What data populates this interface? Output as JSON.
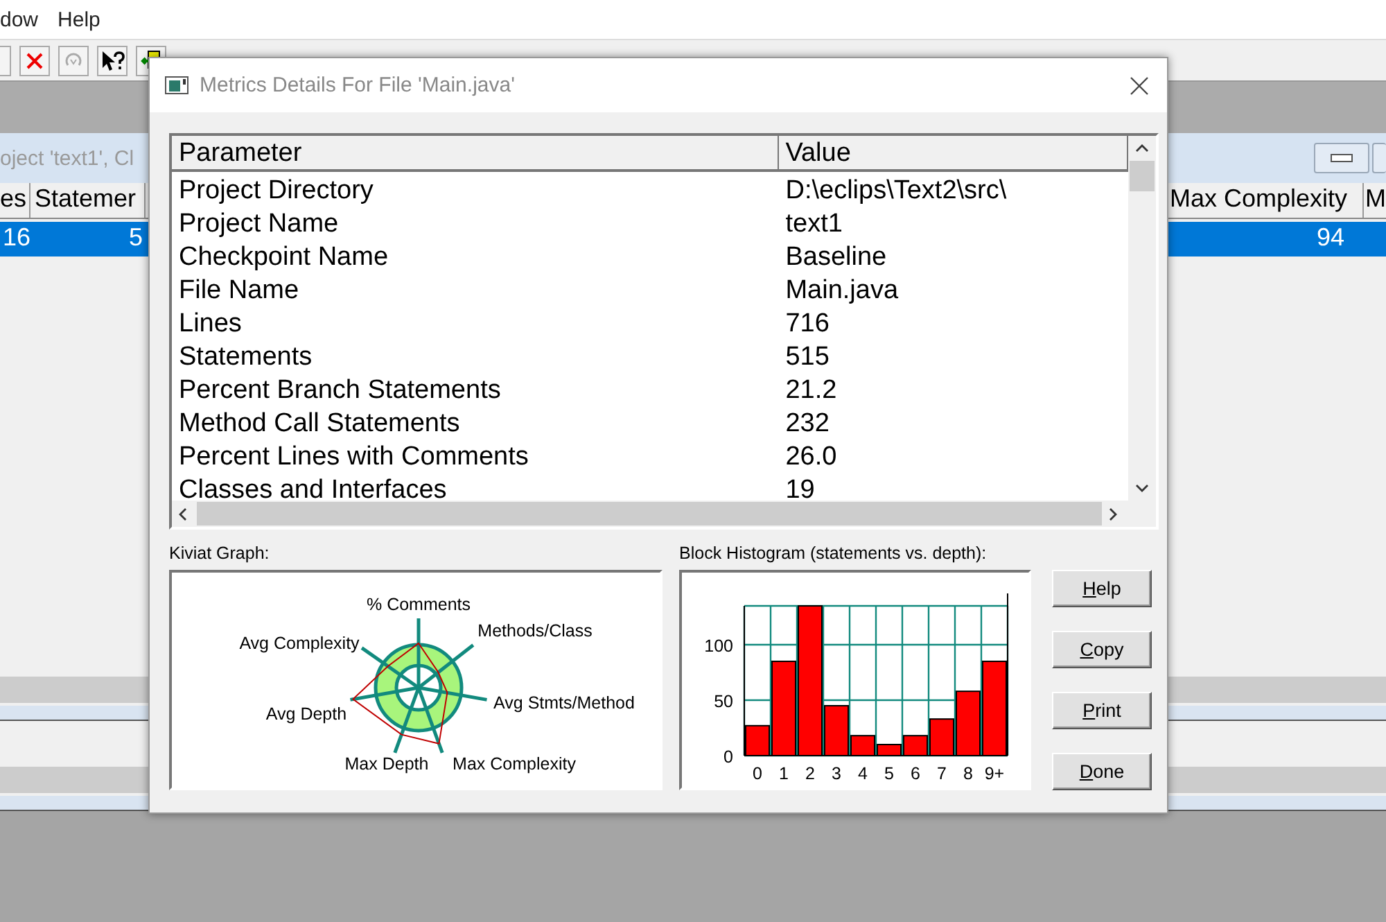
{
  "menu_bar": {
    "items": [
      "dow",
      "Help"
    ]
  },
  "background_window": {
    "title": "oject 'text1', Cl",
    "columns": [
      "es",
      "Statemer",
      "Max Complexity",
      "M"
    ],
    "rows": [
      {
        "cells": [
          "16",
          "5",
          "94"
        ],
        "selected": true
      }
    ]
  },
  "dialog": {
    "title": "Metrics Details For File 'Main.java'",
    "table": {
      "columns": [
        "Parameter",
        "Value"
      ],
      "rows": [
        {
          "parameter": "Project Directory",
          "value": "D:\\eclips\\Text2\\src\\"
        },
        {
          "parameter": "Project Name",
          "value": "text1"
        },
        {
          "parameter": "Checkpoint Name",
          "value": "Baseline"
        },
        {
          "parameter": "File Name",
          "value": "Main.java"
        },
        {
          "parameter": "Lines",
          "value": "716"
        },
        {
          "parameter": "Statements",
          "value": "515"
        },
        {
          "parameter": "Percent Branch Statements",
          "value": "21.2"
        },
        {
          "parameter": "Method Call Statements",
          "value": "232"
        },
        {
          "parameter": "Percent Lines with Comments",
          "value": "26.0"
        },
        {
          "parameter": "Classes and Interfaces",
          "value": "19"
        }
      ]
    },
    "kiviat": {
      "label": "Kiviat Graph:",
      "axis_labels": [
        "% Comments",
        "Methods/Class",
        "Avg Stmts/Method",
        "Max Depth",
        "Max Complexity",
        "Avg Depth",
        "Avg Complexity"
      ]
    },
    "histogram": {
      "label": "Block Histogram (statements vs. depth):",
      "chart_data": {
        "type": "bar",
        "categories": [
          "0",
          "1",
          "2",
          "3",
          "4",
          "5",
          "6",
          "7",
          "8",
          "9+"
        ],
        "series": [
          {
            "color": "#ff0000",
            "values": [
              27,
              85,
              135,
              45,
              18,
              10,
              18,
              33,
              58,
              85
            ]
          }
        ],
        "yticks": [
          0,
          50,
          100
        ],
        "ylim": [
          0,
          135
        ],
        "grid": true
      }
    },
    "buttons": [
      "Help",
      "Copy",
      "Print",
      "Done"
    ]
  }
}
